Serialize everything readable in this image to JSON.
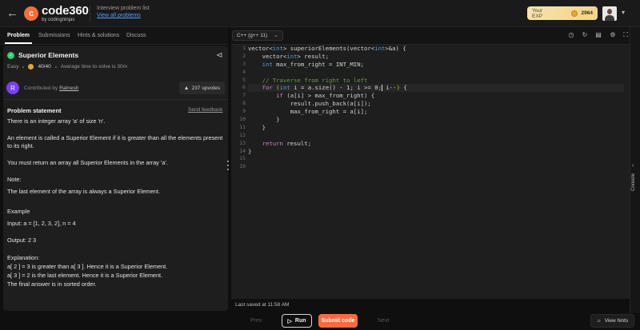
{
  "header": {
    "brand": "code360",
    "brand_sub": "by codingninjas",
    "breadcrumb_label": "Interview problem list",
    "breadcrumb_link": "View all problems",
    "exp_label": "Your EXP",
    "exp_value": "2964"
  },
  "tabs": [
    "Problem",
    "Submissions",
    "Hints & solutions",
    "Discuss"
  ],
  "problem": {
    "title": "Superior Elements",
    "difficulty": "Easy",
    "score": "40/40",
    "avg_time": "Average time to solve is 30m",
    "contributor_initial": "R",
    "contributed_by": "Contributed by",
    "contributor": "Ratnesh",
    "upvotes": "237 upvotes",
    "statement_heading": "Problem statement",
    "send_feedback": "Send feedback",
    "lines": [
      "There is an integer array 'a' of size 'n'.",
      "An element is called a Superior Element if it is greater than all the elements present to its right.",
      "You must return an array all Superior Elements in the array 'a'.",
      "Note:",
      "The last element of the array is always a Superior Element.",
      "Example",
      "Input: a = [1, 2, 3, 2], n = 4",
      "Output: 2 3",
      "Explanation:",
      "a[ 2 ] = 3 is greater than a[ 3 ]. Hence it is a Superior Element.",
      "a[ 3 ] = 2 is the last element. Hence it is a Superior Element.",
      "The final answer is in sorted order."
    ]
  },
  "editor": {
    "language": "C++ (g++ 11)",
    "line_numbers": [
      "1",
      "2",
      "3",
      "4",
      "5",
      "6",
      "7",
      "8",
      "9",
      "10",
      "11",
      "12",
      "13",
      "14",
      "15",
      "16"
    ],
    "last_saved": "Last saved at 11:58 AM",
    "console_label": "Console"
  },
  "footer": {
    "prev": "Prev",
    "run": "Run",
    "submit": "Submit code",
    "next": "Next",
    "view_hints": "View hints"
  },
  "colors": {
    "accent": "#f66c3b",
    "link": "#4ea1ff",
    "success": "#2ecc71"
  }
}
